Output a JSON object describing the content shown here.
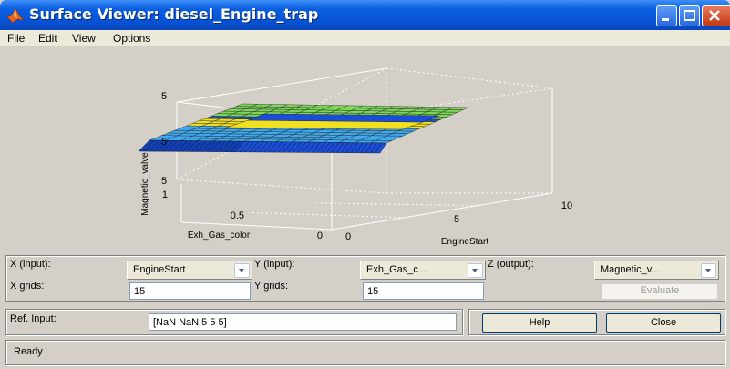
{
  "window": {
    "title": "Surface Viewer: diesel_Engine_trap",
    "menu": [
      "File",
      "Edit",
      "View",
      "Options"
    ]
  },
  "plot": {
    "z_label": "Magnetic_valve",
    "x_label": "EngineStart",
    "y_label": "Exh_Gas_color",
    "z_ticks": [
      "5",
      "5",
      "5"
    ],
    "x_ticks": [
      "0",
      "5",
      "10"
    ],
    "y_ticks": [
      "1",
      "0.5",
      "0"
    ],
    "colors": {
      "green": "#7dd85a",
      "yellow": "#f0e020",
      "blue": "#1a4ed8",
      "light_blue": "#40aaf0",
      "dark_blue": "#1040b8"
    }
  },
  "controls": {
    "x_input_label": "X (input):",
    "x_input_value": "EngineStart",
    "y_input_label": "Y (input):",
    "y_input_value": "Exh_Gas_c...",
    "z_output_label": "Z (output):",
    "z_output_value": "Magnetic_v...",
    "x_grids_label": "X grids:",
    "x_grids_value": "15",
    "y_grids_label": "Y grids:",
    "y_grids_value": "15",
    "evaluate_label": "Evaluate",
    "ref_input_label": "Ref. Input:",
    "ref_input_value": "[NaN NaN 5 5 5]",
    "help_label": "Help",
    "close_label": "Close",
    "status": "Ready"
  }
}
